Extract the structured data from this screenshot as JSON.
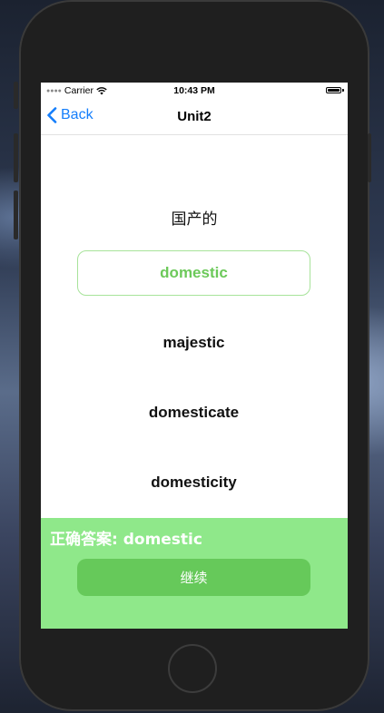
{
  "status_bar": {
    "carrier": "Carrier",
    "time": "10:43 PM"
  },
  "nav": {
    "back_label": "Back",
    "title": "Unit2"
  },
  "quiz": {
    "question": "国产的",
    "options": [
      {
        "label": "domestic",
        "state": "correct"
      },
      {
        "label": "majestic",
        "state": "normal"
      },
      {
        "label": "domesticate",
        "state": "normal"
      },
      {
        "label": "domesticity",
        "state": "normal"
      }
    ]
  },
  "result": {
    "message": "正确答案: domestic",
    "continue_label": "继续"
  },
  "colors": {
    "accent": "#147efb",
    "correct_text": "#6cc95a",
    "result_panel": "#8fe88a",
    "continue_button": "#66c95a"
  },
  "icons": [
    "wifi-icon",
    "battery-icon",
    "chevron-left-icon",
    "home-button-ring"
  ]
}
